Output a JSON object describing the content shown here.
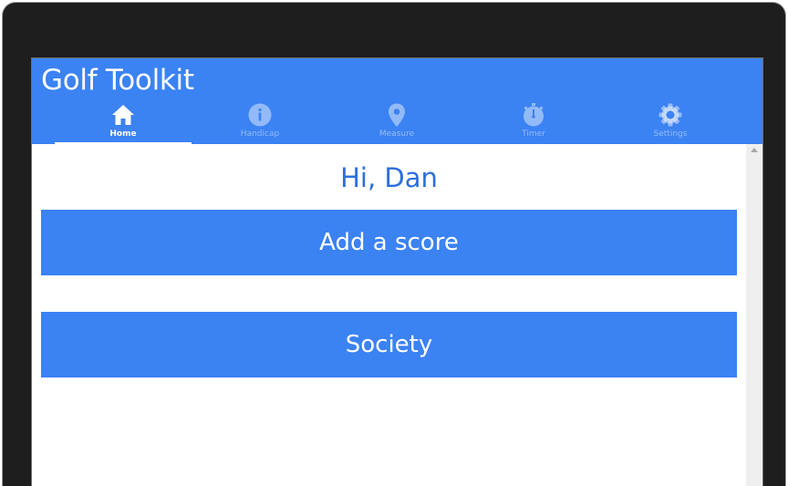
{
  "app": {
    "title": "Golf Toolkit",
    "accent_color": "#3b82f3",
    "greeting_color": "#2d6fdc"
  },
  "tabs": [
    {
      "label": "Home",
      "icon": "home-icon",
      "active": true
    },
    {
      "label": "Handicap",
      "icon": "info-icon",
      "active": false
    },
    {
      "label": "Measure",
      "icon": "map-pin-icon",
      "active": false
    },
    {
      "label": "Timer",
      "icon": "stopwatch-icon",
      "active": false
    },
    {
      "label": "Settings",
      "icon": "gear-icon",
      "active": false
    }
  ],
  "home": {
    "greeting": "Hi, Dan",
    "add_score_label": "Add a score",
    "society_label": "Society"
  }
}
